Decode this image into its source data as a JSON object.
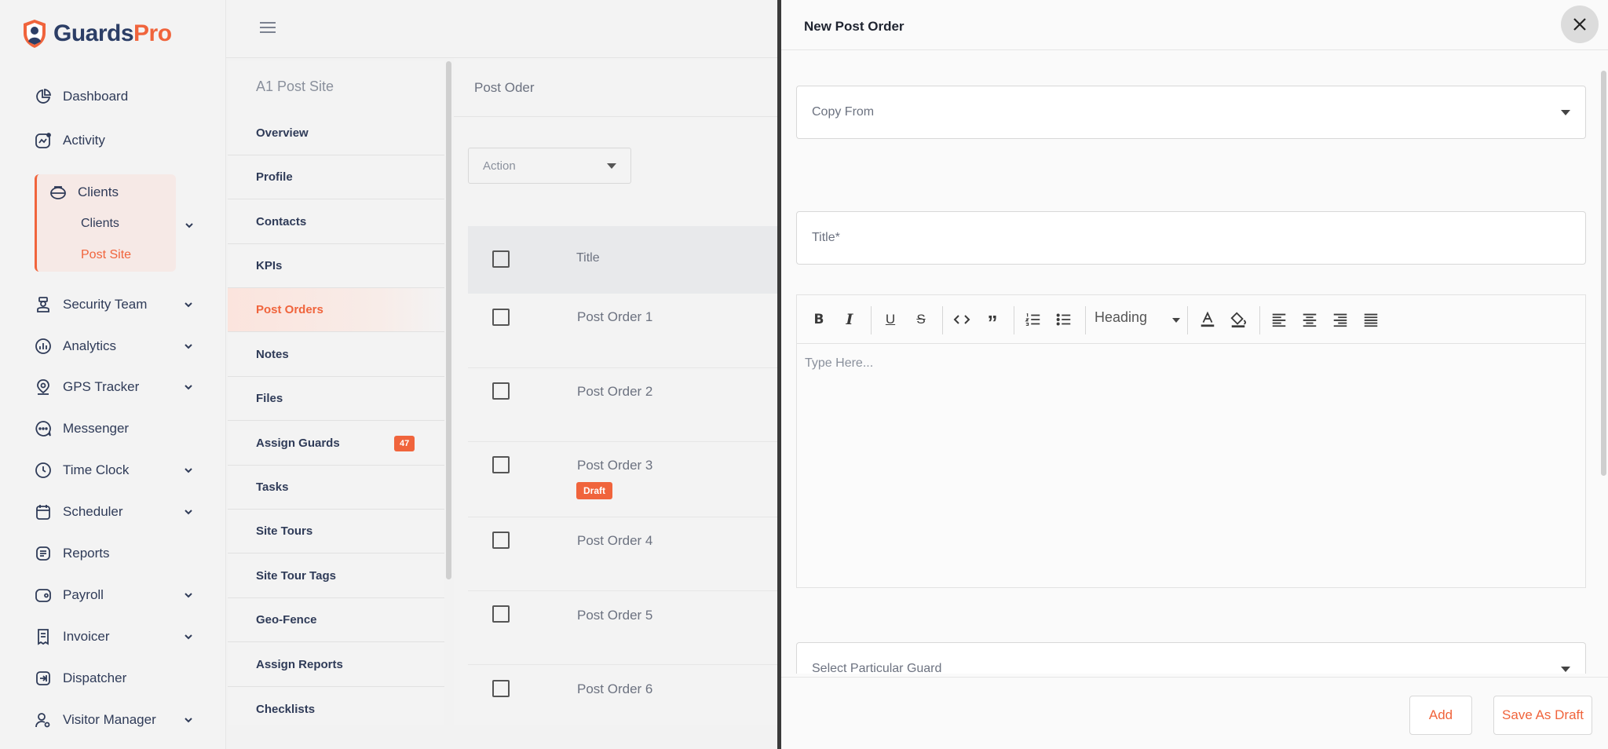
{
  "brand": {
    "name_main": "Guards",
    "name_accent": "Pro",
    "accent_color": "#f0643c"
  },
  "sidebar": {
    "items": [
      {
        "label": "Dashboard"
      },
      {
        "label": "Activity"
      },
      {
        "label": "Security Team"
      },
      {
        "label": "Analytics"
      },
      {
        "label": "GPS Tracker"
      },
      {
        "label": "Messenger"
      },
      {
        "label": "Time Clock"
      },
      {
        "label": "Scheduler"
      },
      {
        "label": "Reports"
      },
      {
        "label": "Payroll"
      },
      {
        "label": "Invoicer"
      },
      {
        "label": "Dispatcher"
      },
      {
        "label": "Visitor Manager"
      }
    ],
    "clients_group": {
      "label": "Clients",
      "sub": [
        "Clients",
        "Post Site"
      ]
    }
  },
  "submenu": {
    "title": "A1 Post Site",
    "items": [
      {
        "label": "Overview"
      },
      {
        "label": "Profile"
      },
      {
        "label": "Contacts"
      },
      {
        "label": "KPIs"
      },
      {
        "label": "Post Orders",
        "active": true
      },
      {
        "label": "Notes"
      },
      {
        "label": "Files"
      },
      {
        "label": "Assign Guards",
        "badge": "47"
      },
      {
        "label": "Tasks"
      },
      {
        "label": "Site Tours"
      },
      {
        "label": "Site Tour Tags"
      },
      {
        "label": "Geo-Fence"
      },
      {
        "label": "Assign Reports"
      },
      {
        "label": "Checklists"
      }
    ]
  },
  "content": {
    "title": "Post Oder",
    "action_placeholder": "Action",
    "table": {
      "column_title": "Title",
      "rows": [
        {
          "title": "Post Order 1"
        },
        {
          "title": "Post Order 2"
        },
        {
          "title": "Post Order 3",
          "status": "Draft"
        },
        {
          "title": "Post Order 4"
        },
        {
          "title": "Post Order 5"
        },
        {
          "title": "Post Order 6"
        }
      ]
    }
  },
  "drawer": {
    "title": "New Post Order",
    "copy_from_placeholder": "Copy From",
    "title_placeholder": "Title*",
    "editor": {
      "heading_select": "Heading",
      "placeholder": "Type Here..."
    },
    "guard_placeholder": "Select Particular Guard",
    "buttons": {
      "add": "Add",
      "save_draft": "Save As Draft"
    }
  }
}
